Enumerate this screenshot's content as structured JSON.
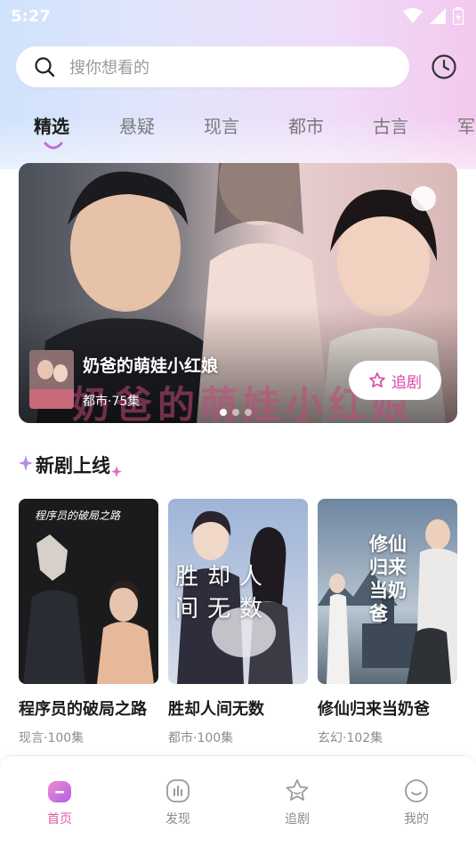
{
  "status_bar": {
    "time": "5:27"
  },
  "search": {
    "placeholder": "搜你想看的"
  },
  "tabs": [
    {
      "label": "精选",
      "active": true
    },
    {
      "label": "悬疑",
      "active": false
    },
    {
      "label": "现言",
      "active": false
    },
    {
      "label": "都市",
      "active": false
    },
    {
      "label": "古言",
      "active": false
    },
    {
      "label": "军",
      "active": false
    }
  ],
  "banner": {
    "title": "奶爸的萌娃小红娘",
    "meta": "都市·75集",
    "follow_label": "追剧",
    "poster_title": "奶爸的萌娃小红娘",
    "page_count": 3,
    "active_page": 0
  },
  "new_section": {
    "title": "新剧上线"
  },
  "dramas": [
    {
      "title": "程序员的破局之路",
      "meta": "现言·100集",
      "cover_text": "程序员的破局之路"
    },
    {
      "title": "胜却人间无数",
      "meta": "都市·100集",
      "cover_text": "胜却人间无数"
    },
    {
      "title": "修仙归来当奶爸",
      "meta": "玄幻·102集",
      "cover_text": "修仙归来当奶爸"
    }
  ],
  "bottom_nav": [
    {
      "label": "首页",
      "icon": "home-icon",
      "active": true
    },
    {
      "label": "发现",
      "icon": "discover-icon",
      "active": false
    },
    {
      "label": "追剧",
      "icon": "star-icon",
      "active": false
    },
    {
      "label": "我的",
      "icon": "profile-icon",
      "active": false
    }
  ],
  "colors": {
    "accent": "#e05aa8",
    "follow_text": "#d94aa6",
    "header_gradient_start": "#cfe3fb",
    "header_gradient_end": "#f3c9ee"
  }
}
